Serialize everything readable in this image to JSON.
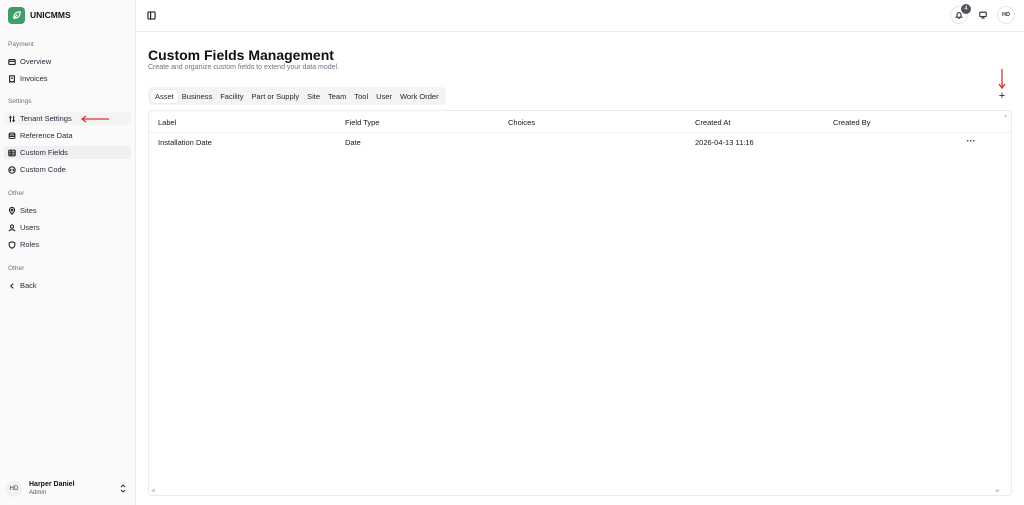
{
  "brand": {
    "name": "UNICMMS",
    "logo_icon": "leaf-logo-icon",
    "logo_color": "#3f9c6b"
  },
  "sidebar": {
    "sections": [
      {
        "label": "Payment",
        "items": [
          {
            "label": "Overview",
            "icon": "credit-card-icon"
          },
          {
            "label": "Invoices",
            "icon": "receipt-icon"
          }
        ]
      },
      {
        "label": "Settings",
        "items": [
          {
            "label": "Tenant Settings",
            "icon": "sliders-icon"
          },
          {
            "label": "Reference Data",
            "icon": "database-icon"
          },
          {
            "label": "Custom Fields",
            "icon": "table-grid-icon"
          },
          {
            "label": "Custom Code",
            "icon": "code-icon"
          }
        ]
      },
      {
        "label": "Other",
        "items": [
          {
            "label": "Sites",
            "icon": "map-pin-icon"
          },
          {
            "label": "Users",
            "icon": "user-icon"
          },
          {
            "label": "Roles",
            "icon": "shield-icon"
          }
        ]
      },
      {
        "label": "Other",
        "items": [
          {
            "label": "Back",
            "icon": "chevron-left-icon"
          }
        ]
      }
    ],
    "active_item": "Custom Fields",
    "user": {
      "initials": "HD",
      "name": "Harper Daniel",
      "role": "Admin"
    }
  },
  "topbar": {
    "notification_count": "4",
    "avatar_initials": "HD"
  },
  "page": {
    "title": "Custom Fields Management",
    "subtitle": "Create and organize custom fields to extend your data model.",
    "add_label": "+"
  },
  "tabs": [
    "Asset",
    "Business",
    "Facility",
    "Part or Supply",
    "Site",
    "Team",
    "Tool",
    "User",
    "Work Order"
  ],
  "active_tab": "Asset",
  "table": {
    "columns": [
      "Label",
      "Field Type",
      "Choices",
      "Created At",
      "Created By"
    ],
    "rows": [
      {
        "label": "Installation Date",
        "field_type": "Date",
        "choices": "",
        "created_at": "2026-04-13 11:16",
        "created_by": "",
        "more": "···"
      }
    ]
  },
  "annotation_color": "#d9342b"
}
